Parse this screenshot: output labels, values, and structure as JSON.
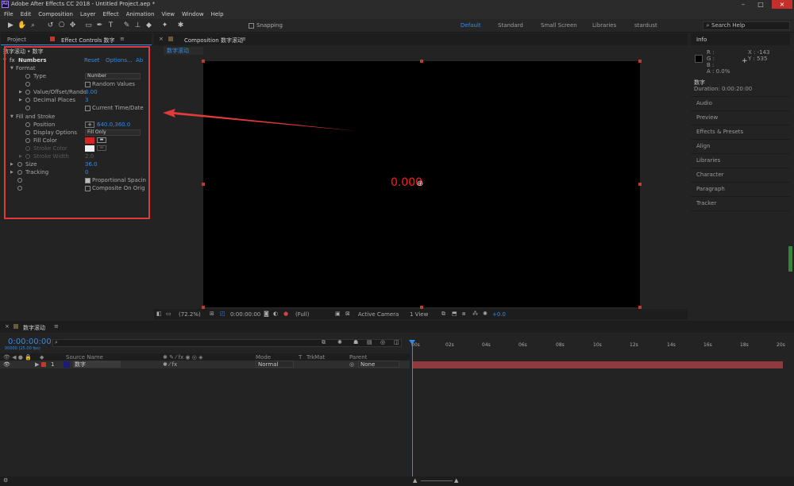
{
  "titlebar": {
    "logo": "Ae",
    "title": "Adobe After Effects CC 2018 - Untitled Project.aep *",
    "controls": [
      "–",
      "□",
      "×"
    ]
  },
  "menubar": {
    "items": [
      "File",
      "Edit",
      "Composition",
      "Layer",
      "Effect",
      "Animation",
      "View",
      "Window",
      "Help"
    ]
  },
  "toolbar": {
    "snapping_label": "Snapping",
    "workspaces": [
      "Default",
      "Standard",
      "Small Screen",
      "Libraries",
      "stardust"
    ],
    "active_workspace": "Default",
    "search_placeholder": "Search Help"
  },
  "effect_panel": {
    "tab_project": "Project",
    "tab_effect_controls": "Effect Controls 数字",
    "breadcrumb": "数字滚动 • 数字",
    "effect_name": "Numbers",
    "reset": "Reset",
    "options": "Options...",
    "about": "Ab",
    "format_label": "Format",
    "type_label": "Type",
    "type_value": "Number",
    "random_values": "Random Values",
    "value_offset": "Value/Offset/Rando",
    "value_offset_val": "0.00",
    "decimal_places": "Decimal Places",
    "decimal_places_val": "3",
    "current_time": "Current Time/Date",
    "fill_stroke": "Fill and Stroke",
    "position_label": "Position",
    "position_val": "640.0,360.0",
    "display_options": "Display Options",
    "display_options_val": "Fill Only",
    "fill_color": "Fill Color",
    "stroke_color": "Stroke Color",
    "stroke_width": "Stroke Width",
    "stroke_width_val": "2.0",
    "size_label": "Size",
    "size_val": "36.0",
    "tracking_label": "Tracking",
    "tracking_val": "0",
    "proportional": "Proportional Spacin",
    "composite": "Composite On Orig"
  },
  "comp_panel": {
    "tab": "Composition 数字滚动",
    "subtab": "数字滚动",
    "value_display": "0.000",
    "zoom": "(72.2%)",
    "time": "0:00:00:00",
    "resolution": "(Full)",
    "camera": "Active Camera",
    "views": "1 View",
    "exposure": "+0.0"
  },
  "right_panel": {
    "info_title": "Info",
    "r": "R :",
    "g": "G :",
    "b": "B :",
    "a": "A : 0.0%",
    "x": "X : -143",
    "y": "Y : 535",
    "comp_name": "数字",
    "duration": "Duration: 0:00:20:00",
    "items": [
      "Audio",
      "Preview",
      "Effects & Presets",
      "Align",
      "Libraries",
      "Character",
      "Paragraph",
      "Tracker"
    ]
  },
  "timeline": {
    "tab": "数字滚动",
    "time": "0:00:00:00",
    "fps": "00000 (25.00 fps)",
    "ruler": [
      "00s",
      "02s",
      "04s",
      "06s",
      "08s",
      "10s",
      "12s",
      "14s",
      "16s",
      "18s",
      "20s"
    ],
    "col_source": "Source Name",
    "col_mode": "Mode",
    "col_t": "T",
    "col_trkmat": "TrkMat",
    "col_parent": "Parent",
    "layer_index": "1",
    "layer_name": "数字",
    "layer_mode": "Normal",
    "layer_parent": "None"
  },
  "colors": {
    "accent": "#2d8ceb",
    "highlight": "#e03a3a",
    "fill": "#e02020",
    "layer_bar": "#8e3a3e"
  }
}
